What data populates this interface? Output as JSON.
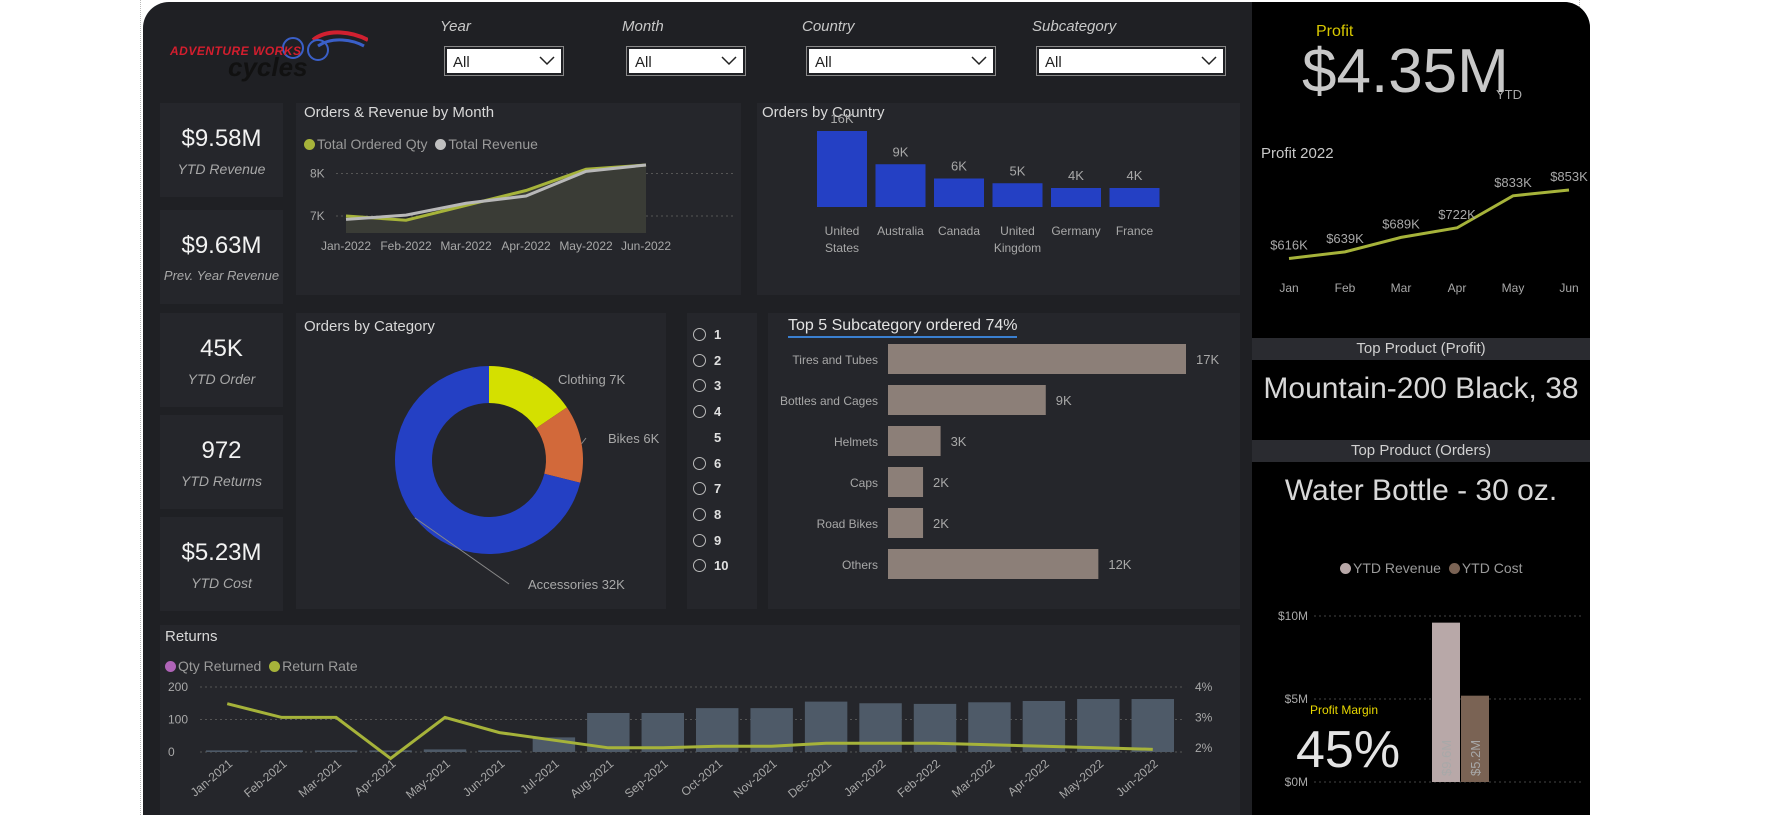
{
  "brand": {
    "line1": "ADVENTURE WORKS",
    "line2": "cycles"
  },
  "filters": [
    {
      "label": "Year",
      "value": "All"
    },
    {
      "label": "Month",
      "value": "All"
    },
    {
      "label": "Country",
      "value": "All"
    },
    {
      "label": "Subcategory",
      "value": "All"
    }
  ],
  "kpis": [
    {
      "value": "$9.58M",
      "label": "YTD Revenue"
    },
    {
      "value": "$9.63M",
      "label": "Prev. Year Revenue"
    },
    {
      "value": "45K",
      "label": "YTD Order"
    },
    {
      "value": "972",
      "label": "YTD Returns"
    },
    {
      "value": "$5.23M",
      "label": "YTD Cost"
    }
  ],
  "orders_revenue": {
    "title": "Orders & Revenue by Month",
    "legend": [
      "Total Ordered Qty",
      "Total Revenue"
    ]
  },
  "orders_country": {
    "title": "Orders by Country"
  },
  "orders_category": {
    "title": "Orders by Category"
  },
  "top5": {
    "title": "Top 5 Subcategory ordered 74%"
  },
  "rank_slicer": [
    "1",
    "2",
    "3",
    "4",
    "5",
    "6",
    "7",
    "8",
    "9",
    "10"
  ],
  "returns": {
    "title": "Returns",
    "legend": [
      "Qty Returned",
      "Return Rate"
    ]
  },
  "profit": {
    "label": "Profit",
    "value": "$4.35M",
    "suffix": "YTD",
    "chart_title": "Profit 2022"
  },
  "top_product_profit": {
    "header": "Top Product (Profit)",
    "value": "Mountain-200 Black, 38"
  },
  "top_product_orders": {
    "header": "Top Product (Orders)",
    "value": "Water Bottle - 30 oz."
  },
  "ytd_compare": {
    "legend": [
      "YTD Revenue",
      "YTD Cost"
    ]
  },
  "profit_margin": {
    "label": "Profit Margin",
    "value": "45%"
  },
  "colors": {
    "bg": "#1f2024",
    "card": "#25262b",
    "olive": "#a6b33a",
    "blue": "#2440c4",
    "taupe": "#8c7f78",
    "yellow": "#d4e000",
    "orange": "#d2693a",
    "slate": "#4e5a68"
  },
  "chart_data": [
    {
      "id": "orders_revenue_month",
      "type": "line",
      "x": [
        "Jan-2022",
        "Feb-2022",
        "Mar-2022",
        "Apr-2022",
        "May-2022",
        "Jun-2022"
      ],
      "y_ticks": [
        "7K",
        "8K"
      ],
      "series": [
        {
          "name": "Total Ordered Qty",
          "values": [
            7000,
            6900,
            7250,
            7600,
            8100,
            8200
          ]
        },
        {
          "name": "Total Revenue",
          "values": [
            6920,
            7020,
            7300,
            7470,
            8050,
            8200
          ]
        }
      ]
    },
    {
      "id": "orders_by_country",
      "type": "bar",
      "categories": [
        "United States",
        "Australia",
        "Canada",
        "United Kingdom",
        "Germany",
        "France"
      ],
      "values": [
        16,
        9,
        6,
        5,
        4,
        4
      ],
      "labels": [
        "16K",
        "9K",
        "6K",
        "5K",
        "4K",
        "4K"
      ]
    },
    {
      "id": "orders_by_category",
      "type": "pie",
      "categories": [
        "Clothing",
        "Bikes",
        "Accessories"
      ],
      "values": [
        7,
        6,
        32
      ],
      "labels": [
        "Clothing 7K",
        "Bikes 6K",
        "Accessories 32K"
      ]
    },
    {
      "id": "top5_subcategory",
      "type": "bar",
      "categories": [
        "Tires and Tubes",
        "Bottles and Cages",
        "Helmets",
        "Caps",
        "Road Bikes",
        "Others"
      ],
      "values": [
        17,
        9,
        3,
        2,
        2,
        12
      ],
      "labels": [
        "17K",
        "9K",
        "3K",
        "2K",
        "2K",
        "12K"
      ]
    },
    {
      "id": "returns",
      "type": "bar",
      "categories": [
        "Jan-2021",
        "Feb-2021",
        "Mar-2021",
        "Apr-2021",
        "May-2021",
        "Jun-2021",
        "Jul-2021",
        "Aug-2021",
        "Sep-2021",
        "Oct-2021",
        "Nov-2021",
        "Dec-2021",
        "Jan-2022",
        "Feb-2022",
        "Mar-2022",
        "Apr-2022",
        "May-2022",
        "Jun-2022"
      ],
      "y_ticks": [
        "0",
        "100",
        "200"
      ],
      "y2_ticks": [
        "2%",
        "3%",
        "4%"
      ],
      "series": [
        {
          "name": "Qty Returned",
          "values": [
            5,
            5,
            5,
            5,
            8,
            5,
            45,
            120,
            120,
            135,
            135,
            155,
            150,
            148,
            153,
            157,
            163,
            163
          ]
        },
        {
          "name": "Return Rate",
          "values": [
            3.45,
            3.0,
            3.0,
            1.65,
            3.0,
            2.5,
            2.25,
            2.0,
            2.0,
            2.05,
            2.05,
            2.15,
            2.15,
            2.15,
            2.1,
            2.05,
            2.0,
            1.95
          ]
        }
      ]
    },
    {
      "id": "profit_2022",
      "type": "line",
      "categories": [
        "Jan",
        "Feb",
        "Mar",
        "Apr",
        "May",
        "Jun"
      ],
      "values": [
        616,
        639,
        689,
        722,
        833,
        853
      ],
      "labels": [
        "$616K",
        "$639K",
        "$689K",
        "$722K",
        "$833K",
        "$853K"
      ]
    },
    {
      "id": "ytd_revenue_cost",
      "type": "bar",
      "categories": [
        "YTD Revenue",
        "YTD Cost"
      ],
      "values": [
        9.6,
        5.2
      ],
      "labels": [
        "$9.6M",
        "$5.2M"
      ],
      "y_ticks": [
        "$0M",
        "$5M",
        "$10M"
      ]
    }
  ]
}
